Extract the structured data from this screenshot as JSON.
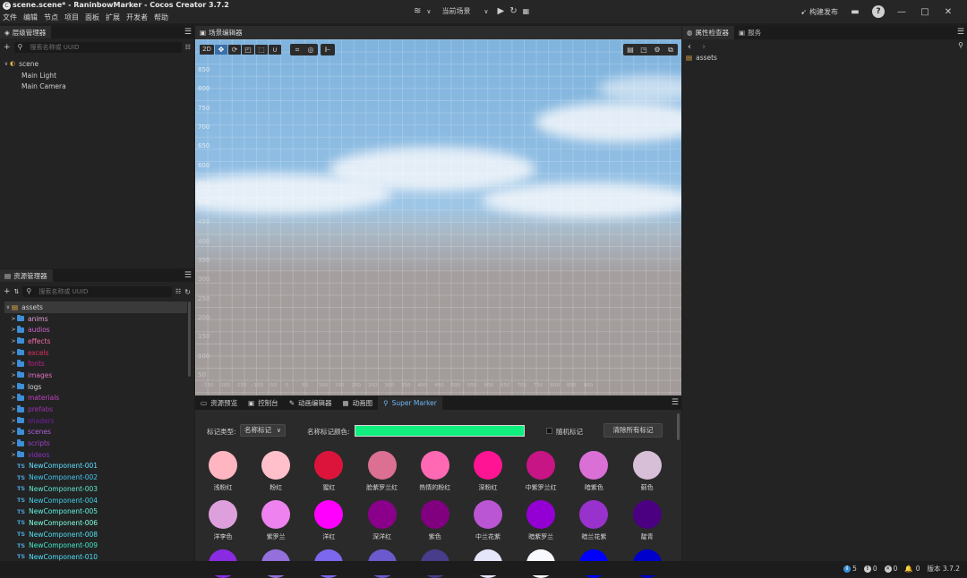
{
  "app": {
    "title": "scene.scene* - RaninbowMarker - Cocos Creator 3.7.2",
    "menu": [
      "文件",
      "编辑",
      "节点",
      "项目",
      "面板",
      "扩展",
      "开发者",
      "帮助"
    ],
    "scene_selector": "当前场景",
    "build_label": "构建发布",
    "help_label": "?"
  },
  "hierarchy": {
    "tab": "层级管理器",
    "search_placeholder": "搜索名称或 UUID",
    "root": "scene",
    "children": [
      "Main Light",
      "Main Camera"
    ]
  },
  "assets": {
    "tab": "资源管理器",
    "search_placeholder": "搜索名称或 UUID",
    "root": "assets",
    "folders": [
      {
        "name": "anims",
        "color": "#e0a0d8"
      },
      {
        "name": "audios",
        "color": "#d063c8"
      },
      {
        "name": "effects",
        "color": "#f070a8"
      },
      {
        "name": "excels",
        "color": "#e03060"
      },
      {
        "name": "fonts",
        "color": "#c0208a"
      },
      {
        "name": "images",
        "color": "#e070c0"
      },
      {
        "name": "logs",
        "color": "#d8d8d8"
      },
      {
        "name": "materials",
        "color": "#c040c0"
      },
      {
        "name": "prefabs",
        "color": "#9a30b0"
      },
      {
        "name": "shaders",
        "color": "#7020a0"
      },
      {
        "name": "scenes",
        "color": "#b060e0"
      },
      {
        "name": "scripts",
        "color": "#a040d0"
      },
      {
        "name": "videos",
        "color": "#9030c0"
      }
    ],
    "scripts": [
      {
        "name": "NewComponent-001",
        "color": "#5fe0ff"
      },
      {
        "name": "NewComponent-002",
        "color": "#40c8f0"
      },
      {
        "name": "NewComponent-003",
        "color": "#5fe8d0"
      },
      {
        "name": "NewComponent-004",
        "color": "#40d0e8"
      },
      {
        "name": "NewComponent-005",
        "color": "#60f0e0"
      },
      {
        "name": "NewComponent-006",
        "color": "#80ffe0"
      },
      {
        "name": "NewComponent-008",
        "color": "#50e0f0"
      },
      {
        "name": "NewComponent-009",
        "color": "#40e8c8"
      },
      {
        "name": "NewComponent-010",
        "color": "#4fe0f8"
      }
    ]
  },
  "scene_editor": {
    "tab": "场景编辑器",
    "mode": "2D",
    "y_ticks": [
      "850",
      "800",
      "750",
      "700",
      "650",
      "600",
      "550",
      "500",
      "450",
      "400",
      "350",
      "300",
      "250",
      "200",
      "150",
      "100",
      "50"
    ],
    "x_ticks": [
      "-150",
      "-200",
      "-150",
      "-100",
      "-50",
      "0",
      "50",
      "100",
      "150",
      "200",
      "250",
      "300",
      "350",
      "400",
      "450",
      "500",
      "550",
      "600",
      "650",
      "700",
      "750",
      "800",
      "850",
      "900"
    ]
  },
  "bottom": {
    "tabs": [
      "资源预览",
      "控制台",
      "动画编辑器",
      "动画图",
      "Super Marker"
    ],
    "marker_type_label": "标记类型:",
    "marker_type_value": "名称标记",
    "marker_color_label": "名称标记颜色:",
    "marker_color": "#0ff07e",
    "random_label": "随机标记",
    "clear_label": "清除所有标记",
    "colors": [
      {
        "name": "浅粉红",
        "hex": "#ffb6c1"
      },
      {
        "name": "粉红",
        "hex": "#ffc0cb"
      },
      {
        "name": "猩红",
        "hex": "#dc143c"
      },
      {
        "name": "脸紫罗兰红",
        "hex": "#db7093"
      },
      {
        "name": "热情的粉红",
        "hex": "#ff69b4"
      },
      {
        "name": "深粉红",
        "hex": "#ff1493"
      },
      {
        "name": "中紫罗兰红",
        "hex": "#c71585"
      },
      {
        "name": "暗紫色",
        "hex": "#da70d6"
      },
      {
        "name": "蓟色",
        "hex": "#d8bfd8"
      },
      {
        "name": "洋李色",
        "hex": "#dda0dd"
      },
      {
        "name": "紫罗兰",
        "hex": "#ee82ee"
      },
      {
        "name": "洋红",
        "hex": "#ff00ff"
      },
      {
        "name": "深洋红",
        "hex": "#8b008b"
      },
      {
        "name": "紫色",
        "hex": "#800080"
      },
      {
        "name": "中兰花紫",
        "hex": "#ba55d3"
      },
      {
        "name": "暗紫罗兰",
        "hex": "#9400d3"
      },
      {
        "name": "暗兰花紫",
        "hex": "#9932cc"
      },
      {
        "name": "靛青",
        "hex": "#4b0082"
      },
      {
        "name": "",
        "hex": "#8a2be2"
      },
      {
        "name": "",
        "hex": "#9370db"
      },
      {
        "name": "",
        "hex": "#7b68ee"
      },
      {
        "name": "",
        "hex": "#6a5acd"
      },
      {
        "name": "",
        "hex": "#483d8b"
      },
      {
        "name": "",
        "hex": "#e6e6fa"
      },
      {
        "name": "",
        "hex": "#f8f8ff"
      },
      {
        "name": "",
        "hex": "#0000ff"
      },
      {
        "name": "",
        "hex": "#0000cd"
      }
    ]
  },
  "inspector": {
    "tabs": [
      "属性检查器",
      "服务"
    ],
    "selected": "assets"
  },
  "status": {
    "info_count": "5",
    "warn_count": "0",
    "error_count": "0",
    "notif_count": "0",
    "version": "版本 3.7.2"
  }
}
